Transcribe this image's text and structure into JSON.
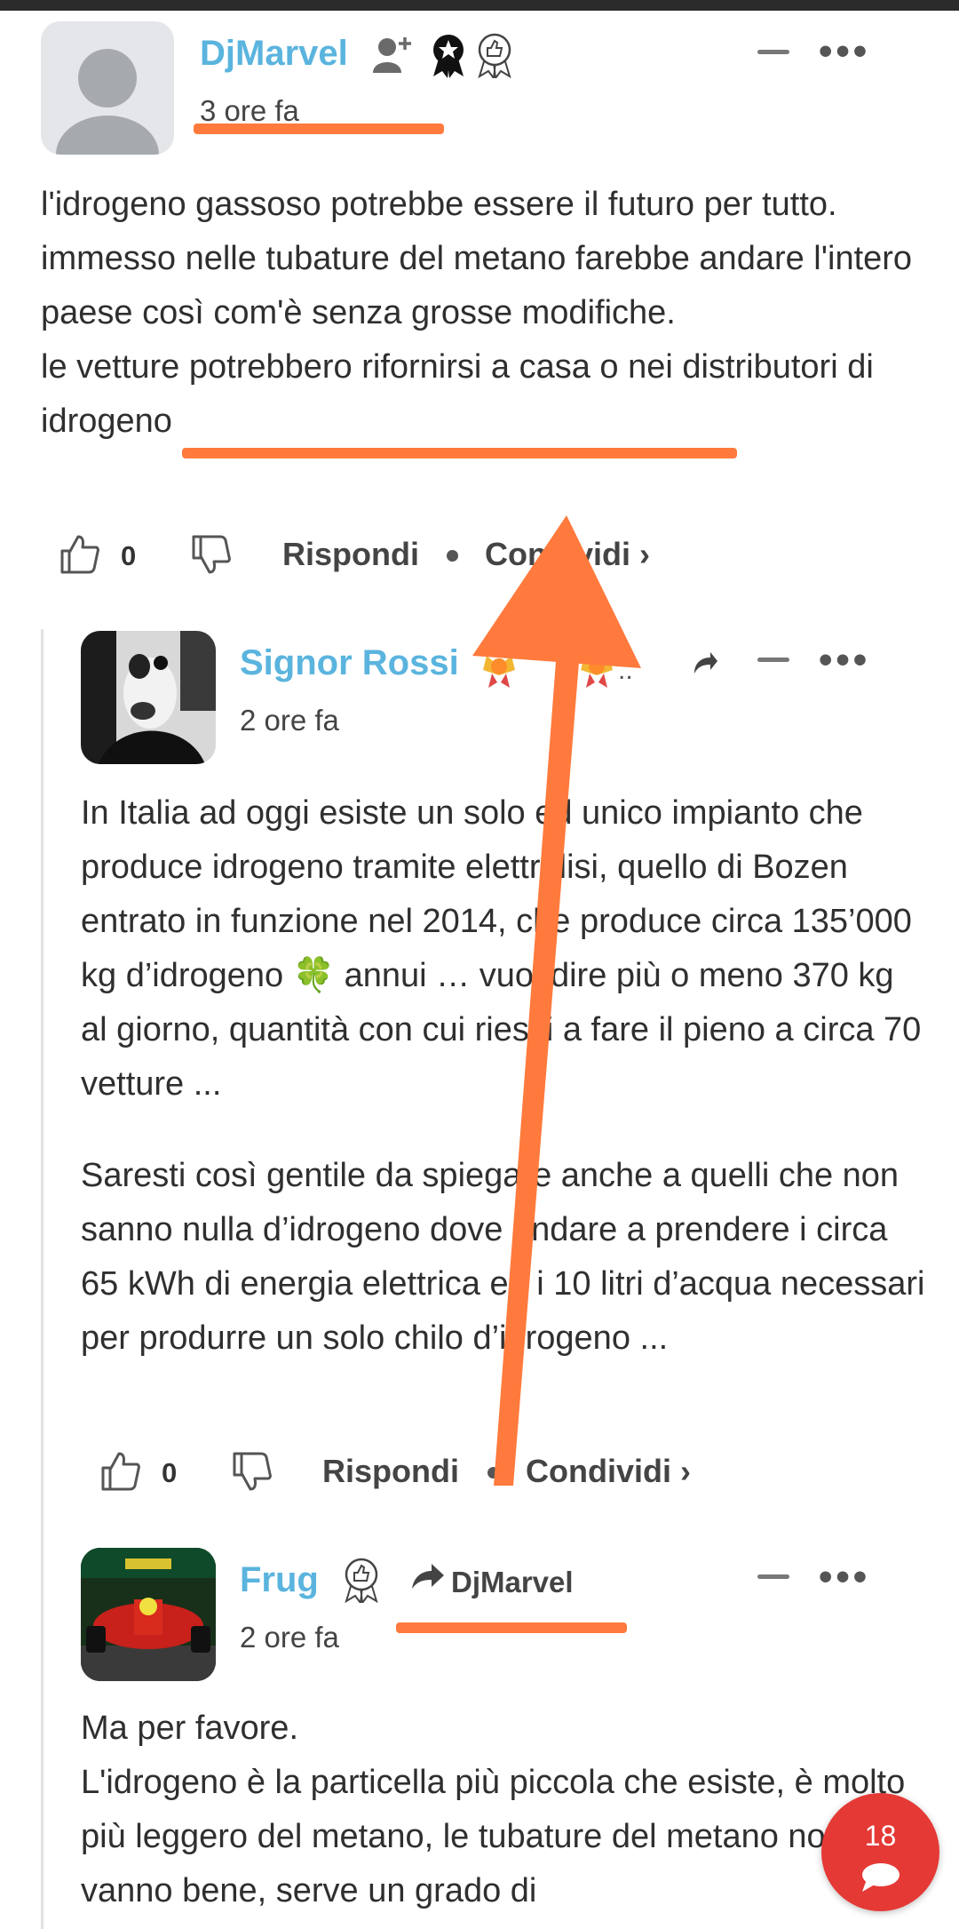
{
  "comments": [
    {
      "author": "DjMarvel",
      "time": "3 ore fa",
      "paragraphs": [
        "l'idrogeno gassoso potrebbe essere il futuro per tutto.",
        "immesso nelle tubature del metano farebbe andare l'intero paese così com'è senza grosse modifiche.",
        "le vetture potrebbero rifornirsi a casa o nei distributori di idrogeno"
      ],
      "likes": "0",
      "reply_label": "Rispondi",
      "share_label": "Condividi ›"
    },
    {
      "author": "Signor Rossi",
      "time": "2 ore fa",
      "paragraphs": [
        "In Italia ad oggi esiste un solo ed unico impianto che produce idrogeno tramite elettrolisi, quello di Bozen entrato in funzione nel 2014, che produce circa 135’000 kg d’idrogeno 🍀 annui … vuol dire più o meno 370 kg al giorno, quantità con cui riesci a fare il pieno a circa 70 vetture ...",
        "Saresti così gentile da spiegare anche a quelli che non sanno nulla d’idrogeno dove andare a prendere i circa 65 kWh di energia elettrica ed i 10 litri d’acqua necessari per produrre un solo chilo d’idrogeno ..."
      ],
      "likes": "0",
      "reply_label": "Rispondi",
      "share_label": "Condividi ›"
    },
    {
      "author": "Frug",
      "reply_to": "DjMarvel",
      "time": "2 ore fa",
      "paragraphs": [
        "Ma per favore.",
        "L'idrogeno è la particella più piccola che esiste, è molto più leggero del metano, le tubature del metano non vanno bene, serve un grado di"
      ]
    }
  ],
  "fab": {
    "count": "18"
  },
  "colors": {
    "username": "#5ab4de",
    "annotation": "#ff7a3c",
    "fab": "#e53935"
  },
  "icons": [
    "follow-icon",
    "badge-icon",
    "thumbs-up-icon",
    "thumbs-down-icon",
    "reply-arrow-icon",
    "minimize-icon",
    "more-icon",
    "chat-bubble-icon"
  ]
}
